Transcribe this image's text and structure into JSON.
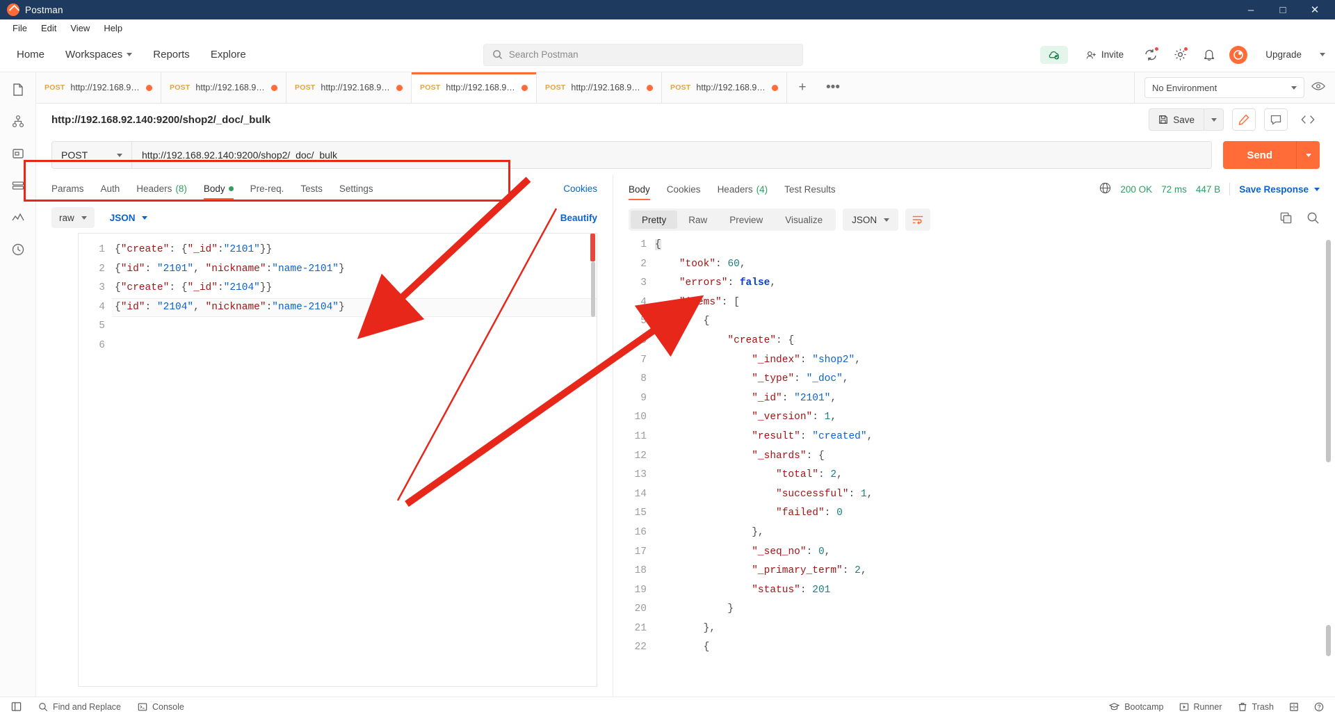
{
  "window": {
    "title": "Postman",
    "controls": {
      "minimize": "–",
      "maximize": "□",
      "close": "✕"
    }
  },
  "menubar": {
    "items": [
      "File",
      "Edit",
      "View",
      "Help"
    ]
  },
  "header": {
    "nav": [
      {
        "label": "Home",
        "caret": false
      },
      {
        "label": "Workspaces",
        "caret": true
      },
      {
        "label": "Reports",
        "caret": false
      },
      {
        "label": "Explore",
        "caret": false
      }
    ],
    "search": {
      "placeholder": "Search Postman",
      "icon": "search-icon"
    },
    "sync_icon": "cloud-sync-icon",
    "invite_label": "Invite",
    "settings_icon": "gear-icon",
    "notifications_icon": "bell-icon",
    "upgrade_label": "Upgrade",
    "accent": "#ff6c37"
  },
  "rail": {
    "icons": [
      "collections-icon",
      "apis-icon",
      "environments-icon",
      "mock-servers-icon",
      "monitors-icon",
      "history-icon"
    ]
  },
  "tabs": {
    "items": [
      {
        "method": "POST",
        "url": "http://192.168.92....",
        "unsaved": true,
        "active": false
      },
      {
        "method": "POST",
        "url": "http://192.168.92....",
        "unsaved": true,
        "active": false
      },
      {
        "method": "POST",
        "url": "http://192.168.92....",
        "unsaved": true,
        "active": false
      },
      {
        "method": "POST",
        "url": "http://192.168.92....",
        "unsaved": true,
        "active": true
      },
      {
        "method": "POST",
        "url": "http://192.168.92....",
        "unsaved": true,
        "active": false
      },
      {
        "method": "POST",
        "url": "http://192.168.92....",
        "unsaved": true,
        "active": false
      }
    ],
    "add_label": "+",
    "more_label": "•••",
    "environment": "No Environment",
    "eye_icon": "eye-icon"
  },
  "request": {
    "title": "http://192.168.92.140:9200/shop2/_doc/_bulk",
    "save_label": "Save",
    "method": "POST",
    "url": "http://192.168.92.140:9200/shop2/_doc/_bulk",
    "send_label": "Send",
    "subtabs": [
      {
        "label": "Params",
        "active": false
      },
      {
        "label": "Auth",
        "active": false
      },
      {
        "label": "Headers",
        "count": "(8)",
        "active": false
      },
      {
        "label": "Body",
        "dot": true,
        "active": true
      },
      {
        "label": "Pre-req.",
        "active": false
      },
      {
        "label": "Tests",
        "active": false
      },
      {
        "label": "Settings",
        "active": false
      }
    ],
    "cookies_link": "Cookies",
    "body_mode": "raw",
    "body_format": "JSON",
    "beautify_label": "Beautify",
    "body_lines": [
      {
        "n": "1",
        "tokens": [
          {
            "t": "{",
            "c": "p"
          },
          {
            "t": "\"create\"",
            "c": "k"
          },
          {
            "t": ": ",
            "c": "p"
          },
          {
            "t": "{",
            "c": "p"
          },
          {
            "t": "\"_id\"",
            "c": "k"
          },
          {
            "t": ":",
            "c": "p"
          },
          {
            "t": "\"2101\"",
            "c": "s"
          },
          {
            "t": "}}",
            "c": "p"
          }
        ]
      },
      {
        "n": "2",
        "tokens": [
          {
            "t": "{",
            "c": "p"
          },
          {
            "t": "\"id\"",
            "c": "k"
          },
          {
            "t": ": ",
            "c": "p"
          },
          {
            "t": "\"2101\"",
            "c": "s"
          },
          {
            "t": ", ",
            "c": "p"
          },
          {
            "t": "\"nickname\"",
            "c": "k"
          },
          {
            "t": ":",
            "c": "p"
          },
          {
            "t": "\"name-2101\"",
            "c": "s"
          },
          {
            "t": "}",
            "c": "p"
          }
        ]
      },
      {
        "n": "3",
        "tokens": [
          {
            "t": "{",
            "c": "p"
          },
          {
            "t": "\"create\"",
            "c": "k"
          },
          {
            "t": ": ",
            "c": "p"
          },
          {
            "t": "{",
            "c": "p"
          },
          {
            "t": "\"_id\"",
            "c": "k"
          },
          {
            "t": ":",
            "c": "p"
          },
          {
            "t": "\"2104\"",
            "c": "s"
          },
          {
            "t": "}}",
            "c": "p"
          }
        ]
      },
      {
        "n": "4",
        "cur": true,
        "tokens": [
          {
            "t": "{",
            "c": "p"
          },
          {
            "t": "\"id\"",
            "c": "k"
          },
          {
            "t": ": ",
            "c": "p"
          },
          {
            "t": "\"2104\"",
            "c": "s"
          },
          {
            "t": ", ",
            "c": "p"
          },
          {
            "t": "\"nickname\"",
            "c": "k"
          },
          {
            "t": ":",
            "c": "p"
          },
          {
            "t": "\"name-2104\"",
            "c": "s"
          },
          {
            "t": "}",
            "c": "p"
          }
        ]
      },
      {
        "n": "5",
        "tokens": []
      },
      {
        "n": "6",
        "tokens": []
      }
    ]
  },
  "response": {
    "tabs": [
      {
        "label": "Body",
        "active": true
      },
      {
        "label": "Cookies",
        "active": false
      },
      {
        "label": "Headers",
        "count": "(4)",
        "active": false
      },
      {
        "label": "Test Results",
        "active": false
      }
    ],
    "globe_icon": "globe-icon",
    "status": "200 OK",
    "time": "72 ms",
    "size": "447 B",
    "save_response_label": "Save Response",
    "view_modes": [
      {
        "label": "Pretty",
        "active": true
      },
      {
        "label": "Raw",
        "active": false
      },
      {
        "label": "Preview",
        "active": false
      },
      {
        "label": "Visualize",
        "active": false
      }
    ],
    "format": "JSON",
    "wrap_icon": "wrap-lines-icon",
    "copy_icon": "copy-icon",
    "search_icon": "search-icon",
    "lines": [
      {
        "n": "1",
        "indent": 0,
        "first": true,
        "tokens": [
          {
            "t": "{",
            "c": "p"
          }
        ]
      },
      {
        "n": "2",
        "indent": 1,
        "tokens": [
          {
            "t": "\"took\"",
            "c": "k"
          },
          {
            "t": ": ",
            "c": "p"
          },
          {
            "t": "60",
            "c": "n"
          },
          {
            "t": ",",
            "c": "p"
          }
        ]
      },
      {
        "n": "3",
        "indent": 1,
        "tokens": [
          {
            "t": "\"errors\"",
            "c": "k"
          },
          {
            "t": ": ",
            "c": "p"
          },
          {
            "t": "false",
            "c": "b"
          },
          {
            "t": ",",
            "c": "p"
          }
        ]
      },
      {
        "n": "4",
        "indent": 1,
        "tokens": [
          {
            "t": "\"items\"",
            "c": "k"
          },
          {
            "t": ": ",
            "c": "p"
          },
          {
            "t": "[",
            "c": "p"
          }
        ]
      },
      {
        "n": "5",
        "indent": 2,
        "tokens": [
          {
            "t": "{",
            "c": "p"
          }
        ]
      },
      {
        "n": "6",
        "indent": 3,
        "tokens": [
          {
            "t": "\"create\"",
            "c": "k"
          },
          {
            "t": ": ",
            "c": "p"
          },
          {
            "t": "{",
            "c": "p"
          }
        ]
      },
      {
        "n": "7",
        "indent": 4,
        "tokens": [
          {
            "t": "\"_index\"",
            "c": "k"
          },
          {
            "t": ": ",
            "c": "p"
          },
          {
            "t": "\"shop2\"",
            "c": "s"
          },
          {
            "t": ",",
            "c": "p"
          }
        ]
      },
      {
        "n": "8",
        "indent": 4,
        "tokens": [
          {
            "t": "\"_type\"",
            "c": "k"
          },
          {
            "t": ": ",
            "c": "p"
          },
          {
            "t": "\"_doc\"",
            "c": "s"
          },
          {
            "t": ",",
            "c": "p"
          }
        ]
      },
      {
        "n": "9",
        "indent": 4,
        "tokens": [
          {
            "t": "\"_id\"",
            "c": "k"
          },
          {
            "t": ": ",
            "c": "p"
          },
          {
            "t": "\"2101\"",
            "c": "s"
          },
          {
            "t": ",",
            "c": "p"
          }
        ]
      },
      {
        "n": "10",
        "indent": 4,
        "tokens": [
          {
            "t": "\"_version\"",
            "c": "k"
          },
          {
            "t": ": ",
            "c": "p"
          },
          {
            "t": "1",
            "c": "n"
          },
          {
            "t": ",",
            "c": "p"
          }
        ]
      },
      {
        "n": "11",
        "indent": 4,
        "tokens": [
          {
            "t": "\"result\"",
            "c": "k"
          },
          {
            "t": ": ",
            "c": "p"
          },
          {
            "t": "\"created\"",
            "c": "s"
          },
          {
            "t": ",",
            "c": "p"
          }
        ]
      },
      {
        "n": "12",
        "indent": 4,
        "tokens": [
          {
            "t": "\"_shards\"",
            "c": "k"
          },
          {
            "t": ": ",
            "c": "p"
          },
          {
            "t": "{",
            "c": "p"
          }
        ]
      },
      {
        "n": "13",
        "indent": 5,
        "tokens": [
          {
            "t": "\"total\"",
            "c": "k"
          },
          {
            "t": ": ",
            "c": "p"
          },
          {
            "t": "2",
            "c": "n"
          },
          {
            "t": ",",
            "c": "p"
          }
        ]
      },
      {
        "n": "14",
        "indent": 5,
        "tokens": [
          {
            "t": "\"successful\"",
            "c": "k"
          },
          {
            "t": ": ",
            "c": "p"
          },
          {
            "t": "1",
            "c": "n"
          },
          {
            "t": ",",
            "c": "p"
          }
        ]
      },
      {
        "n": "15",
        "indent": 5,
        "tokens": [
          {
            "t": "\"failed\"",
            "c": "k"
          },
          {
            "t": ": ",
            "c": "p"
          },
          {
            "t": "0",
            "c": "n"
          }
        ]
      },
      {
        "n": "16",
        "indent": 4,
        "tokens": [
          {
            "t": "},",
            "c": "p"
          }
        ]
      },
      {
        "n": "17",
        "indent": 4,
        "tokens": [
          {
            "t": "\"_seq_no\"",
            "c": "k"
          },
          {
            "t": ": ",
            "c": "p"
          },
          {
            "t": "0",
            "c": "n"
          },
          {
            "t": ",",
            "c": "p"
          }
        ]
      },
      {
        "n": "18",
        "indent": 4,
        "tokens": [
          {
            "t": "\"_primary_term\"",
            "c": "k"
          },
          {
            "t": ": ",
            "c": "p"
          },
          {
            "t": "2",
            "c": "n"
          },
          {
            "t": ",",
            "c": "p"
          }
        ]
      },
      {
        "n": "19",
        "indent": 4,
        "tokens": [
          {
            "t": "\"status\"",
            "c": "k"
          },
          {
            "t": ": ",
            "c": "p"
          },
          {
            "t": "201",
            "c": "n"
          }
        ]
      },
      {
        "n": "20",
        "indent": 3,
        "tokens": [
          {
            "t": "}",
            "c": "p"
          }
        ]
      },
      {
        "n": "21",
        "indent": 2,
        "tokens": [
          {
            "t": "},",
            "c": "p"
          }
        ]
      },
      {
        "n": "22",
        "indent": 2,
        "tokens": [
          {
            "t": "{",
            "c": "p"
          }
        ]
      }
    ]
  },
  "footer": {
    "left": [
      {
        "icon": "sidebar-toggle-icon",
        "label": ""
      },
      {
        "icon": "search-icon",
        "label": "Find and Replace"
      },
      {
        "icon": "console-icon",
        "label": "Console"
      }
    ],
    "right": [
      {
        "icon": "bootcamp-icon",
        "label": "Bootcamp"
      },
      {
        "icon": "runner-icon",
        "label": "Runner"
      },
      {
        "icon": "trash-icon",
        "label": "Trash"
      },
      {
        "icon": "layout-icon",
        "label": ""
      },
      {
        "icon": "help-icon",
        "label": ""
      }
    ]
  },
  "annotations": {
    "color": "#e8271b",
    "rect_label": "url-bar-highlight",
    "arrow1_label": "arrow-to-request-body",
    "arrow2_label": "arrow-to-errors-field"
  }
}
